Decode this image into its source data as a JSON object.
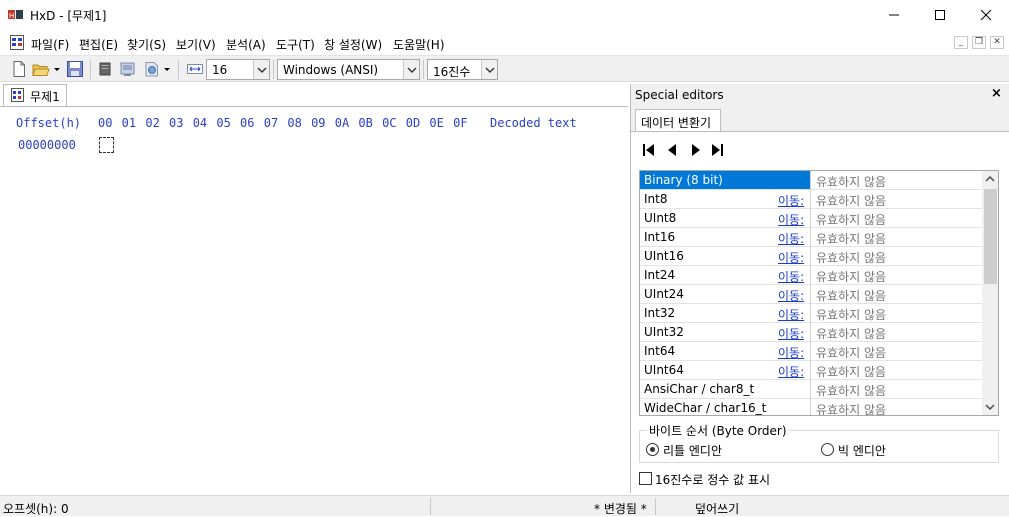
{
  "window": {
    "title": "HxD - [무제1]",
    "minimize_glyph": "─",
    "maximize_glyph": "☐",
    "close_glyph": "✕"
  },
  "menu": {
    "items": [
      {
        "label": "파일(F)"
      },
      {
        "label": "편집(E)"
      },
      {
        "label": "찾기(S)"
      },
      {
        "label": "보기(V)"
      },
      {
        "label": "분석(A)"
      },
      {
        "label": "도구(T)"
      },
      {
        "label": "창 설정(W)"
      },
      {
        "label": "도움말(H)"
      }
    ],
    "mdi_minimize": "_",
    "mdi_restore": "❐",
    "mdi_close": "✕"
  },
  "toolbar": {
    "icons": [
      "new-file-icon",
      "open-folder-icon",
      "save-icon",
      "disk-icon",
      "ram-icon",
      "export-icon",
      "columns-icon"
    ],
    "bytes_per_row": "16",
    "charset": "Windows (ANSI)",
    "offset_base": "16진수"
  },
  "document": {
    "tab_label": "무제1",
    "header_offset": "Offset(h)",
    "header_columns": "00 01 02 03 04 05 06 07 08 09 0A 0B 0C 0D 0E 0F",
    "header_decoded": "Decoded text",
    "first_offset": "00000000"
  },
  "panel": {
    "title": "Special editors",
    "close_glyph": "×",
    "tab_label": "데이터 변환기",
    "rows": [
      {
        "name": "Binary (8 bit)",
        "goto": "",
        "value": "유효하지 않음",
        "selected": true
      },
      {
        "name": "Int8",
        "goto": "이동:",
        "value": "유효하지 않음"
      },
      {
        "name": "UInt8",
        "goto": "이동:",
        "value": "유효하지 않음"
      },
      {
        "name": "Int16",
        "goto": "이동:",
        "value": "유효하지 않음"
      },
      {
        "name": "UInt16",
        "goto": "이동:",
        "value": "유효하지 않음"
      },
      {
        "name": "Int24",
        "goto": "이동:",
        "value": "유효하지 않음"
      },
      {
        "name": "UInt24",
        "goto": "이동:",
        "value": "유효하지 않음"
      },
      {
        "name": "Int32",
        "goto": "이동:",
        "value": "유효하지 않음"
      },
      {
        "name": "UInt32",
        "goto": "이동:",
        "value": "유효하지 않음"
      },
      {
        "name": "Int64",
        "goto": "이동:",
        "value": "유효하지 않음"
      },
      {
        "name": "UInt64",
        "goto": "이동:",
        "value": "유효하지 않음"
      },
      {
        "name": "AnsiChar / char8_t",
        "goto": "",
        "value": "유효하지 않음"
      },
      {
        "name": "WideChar / char16_t",
        "goto": "",
        "value": "유효하지 않음"
      }
    ],
    "byte_order_label": "바이트 순서 (Byte Order)",
    "little_endian": "리틀 엔디안",
    "big_endian": "빅 엔디안",
    "hex_checkbox_label": "16진수로 정수 값 표시"
  },
  "status": {
    "offset": "오프셋(h): 0",
    "modified": "* 변경됨 *",
    "mode": "덮어쓰기"
  }
}
